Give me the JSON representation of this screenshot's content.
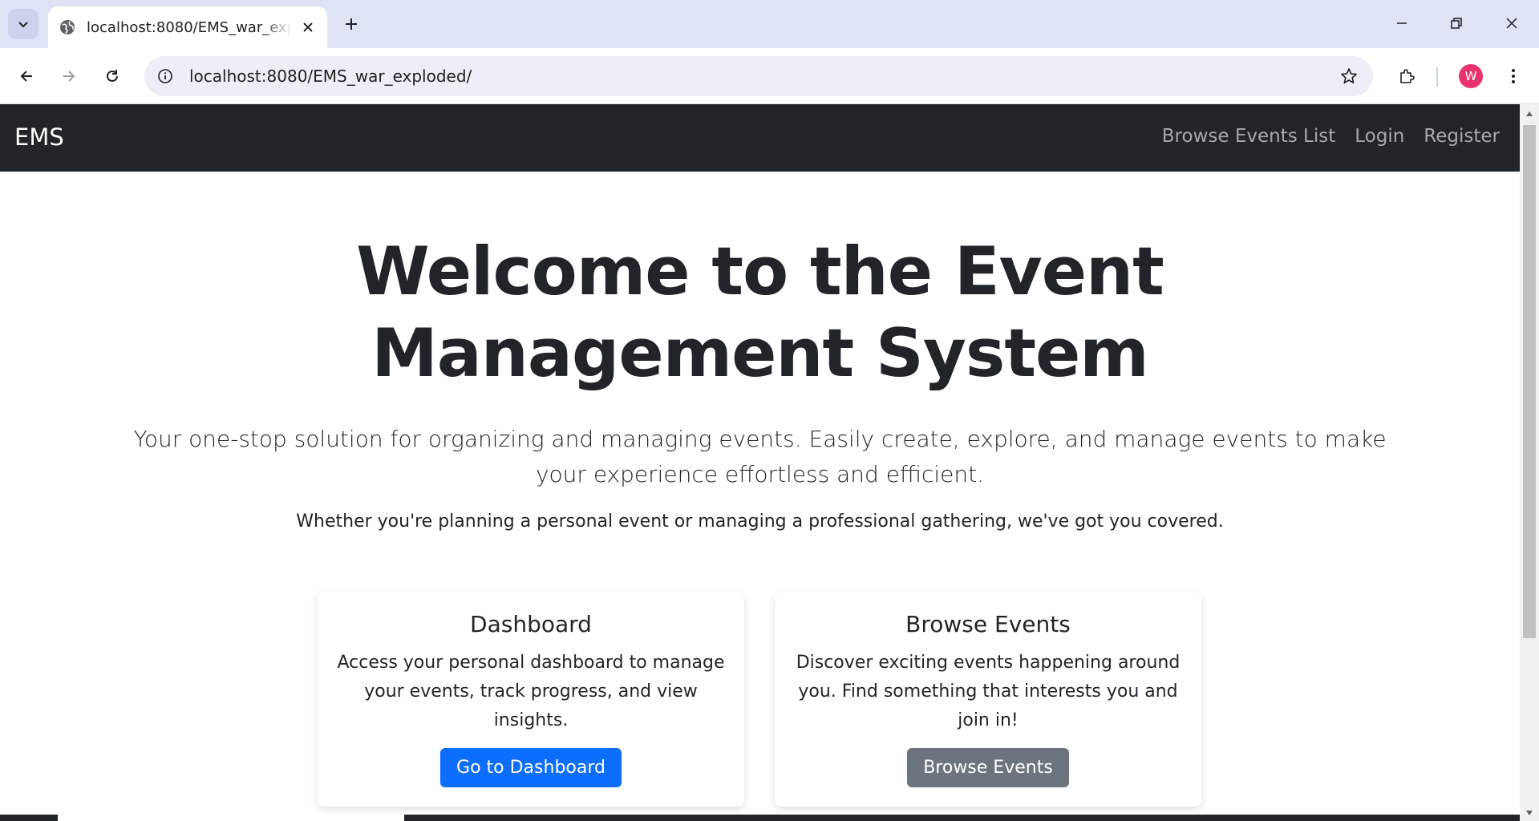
{
  "browser": {
    "tab_title": "localhost:8080/EMS_war_exploded/",
    "url": "localhost:8080/EMS_war_exploded/",
    "profile_initial": "W",
    "colors": {
      "tabstrip": "#dee3f5",
      "omnibox": "#eceff7",
      "avatar": "#e8336d"
    }
  },
  "navbar": {
    "brand": "EMS",
    "links": [
      "Browse Events List",
      "Login",
      "Register"
    ]
  },
  "hero": {
    "title": "Welcome to the Event Management System",
    "lead": "Your one-stop solution for organizing and managing events. Easily create, explore, and manage events to make your experience effortless and efficient.",
    "subtext": "Whether you're planning a personal event or managing a professional gathering, we've got you covered."
  },
  "cards": [
    {
      "title": "Dashboard",
      "text": "Access your personal dashboard to manage your events, track progress, and view insights.",
      "button": "Go to Dashboard"
    },
    {
      "title": "Browse Events",
      "text": "Discover exciting events happening around you. Find something that interests you and join in!",
      "button": "Browse Events"
    }
  ],
  "theme": {
    "navbar_bg": "#212529",
    "primary": "#0d6efd",
    "secondary": "#6c757d"
  }
}
